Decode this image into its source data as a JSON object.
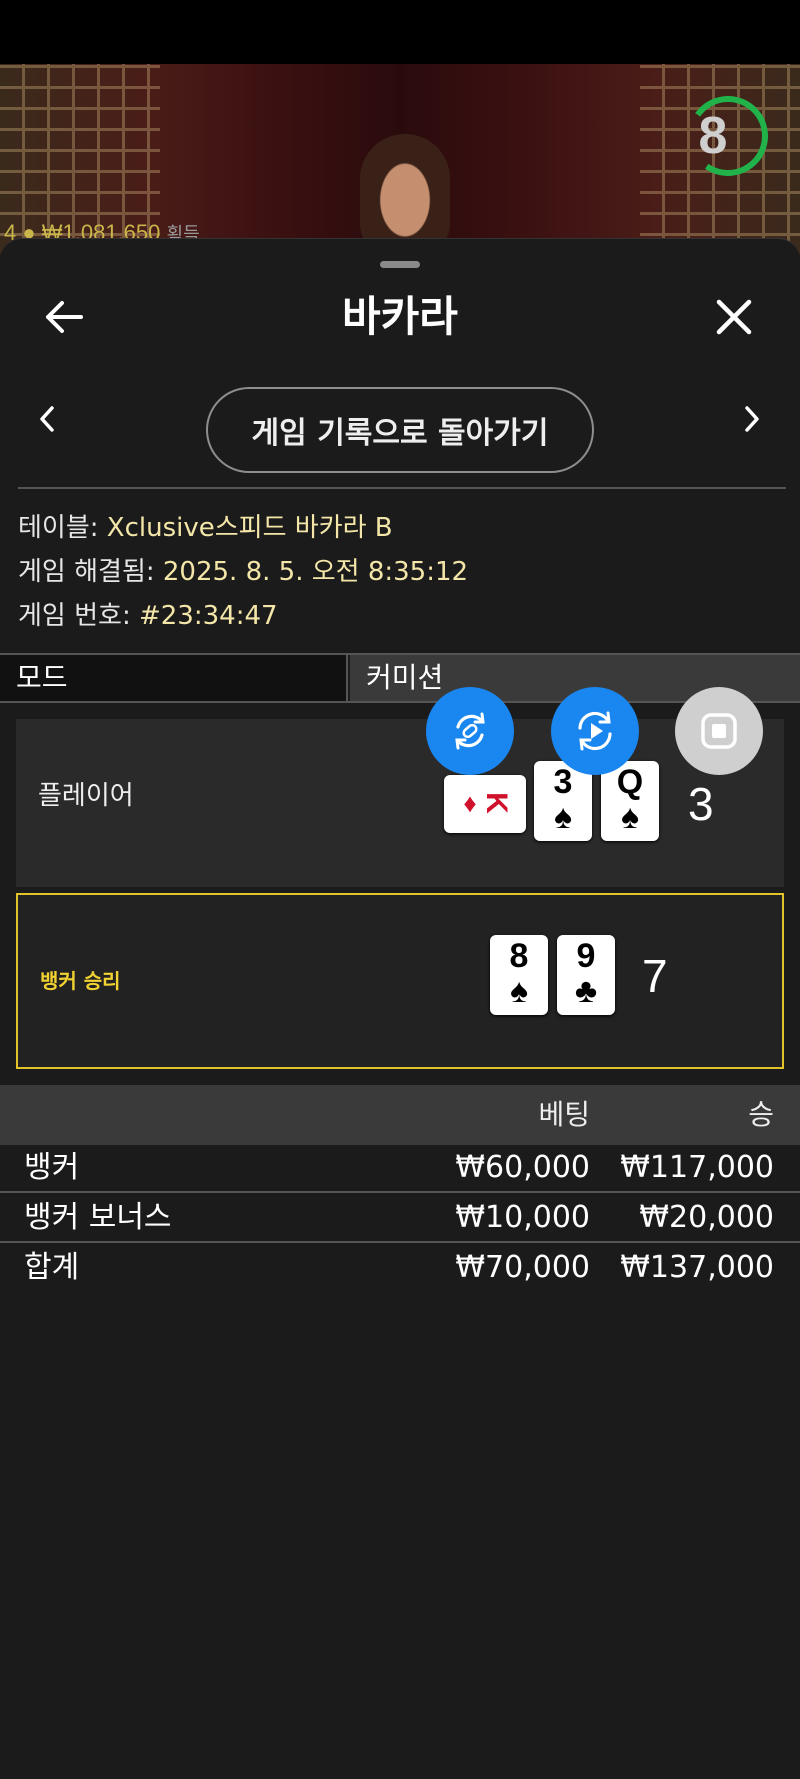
{
  "stream": {
    "timer_value": "8",
    "peek_text": "4 ● ₩1,081,650",
    "peek_suffix": "획득"
  },
  "header": {
    "title": "바카라"
  },
  "history_nav": {
    "back_to_history_label": "게임 기록으로 돌아가기"
  },
  "game_info": {
    "table_label": "테이블: ",
    "table_value": "Xclusive스피드 바카라 B",
    "resolved_label": "게임 해결됨: ",
    "resolved_value": "2025. 8. 5. 오전 8:35:12",
    "game_no_label": "게임 번호: ",
    "game_no_value": "#23:34:47"
  },
  "mode": {
    "label": "모드",
    "value": "커미션"
  },
  "hands": {
    "player": {
      "label": "플레이어",
      "cards": [
        {
          "rank": "K",
          "suit": "♦",
          "rotated": true
        },
        {
          "rank": "3",
          "suit": "♠",
          "rotated": false
        },
        {
          "rank": "Q",
          "suit": "♠",
          "rotated": false
        }
      ],
      "score": "3"
    },
    "banker": {
      "label": "뱅커 승리",
      "cards": [
        {
          "rank": "8",
          "suit": "♠",
          "rotated": false
        },
        {
          "rank": "9",
          "suit": "♣",
          "rotated": false
        }
      ],
      "score": "7"
    }
  },
  "bets": {
    "col_bet": "베팅",
    "col_win": "승",
    "rows": [
      {
        "name": "뱅커",
        "bet": "₩60,000",
        "win": "₩117,000"
      },
      {
        "name": "뱅커 보너스",
        "bet": "₩10,000",
        "win": "₩20,000"
      }
    ],
    "total": {
      "name": "합계",
      "bet": "₩70,000",
      "win": "₩137,000"
    }
  },
  "colors": {
    "accent_yellow": "#e2c42a",
    "fab_blue": "#1a87f0",
    "timer_green": "#21b24a"
  }
}
